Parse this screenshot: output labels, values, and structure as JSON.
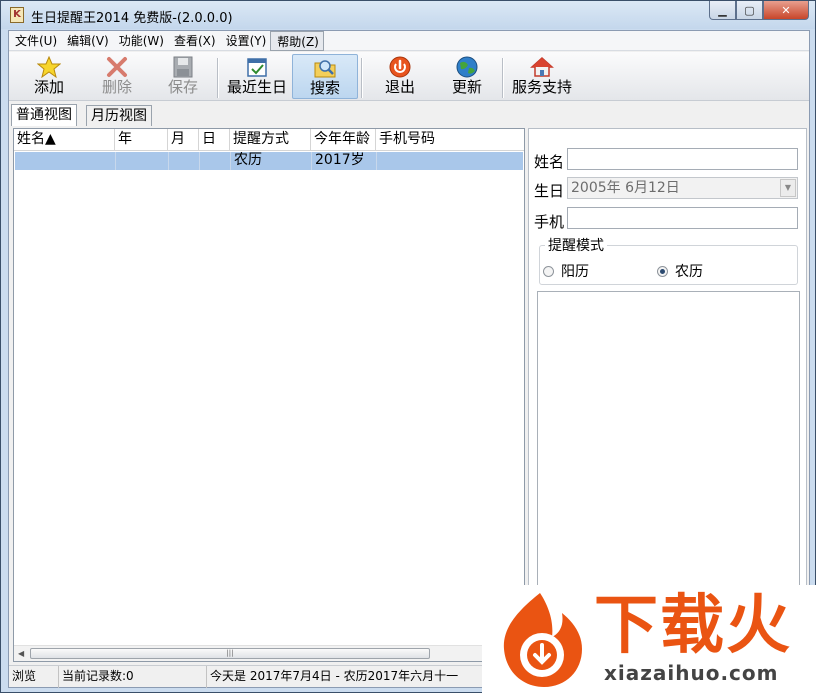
{
  "window": {
    "title": "生日提醒王2014 免费版-(2.0.0.0)",
    "app_icon": "K",
    "minimize": "▁",
    "maximize": "▢",
    "close": "✕"
  },
  "menu": [
    "文件(U)",
    "编辑(V)",
    "功能(W)",
    "查看(X)",
    "设置(Y)",
    "帮助(Z)"
  ],
  "toolbar": {
    "add": "添加",
    "delete": "删除",
    "save": "保存",
    "recent": "最近生日",
    "search": "搜索",
    "exit": "退出",
    "update": "更新",
    "support": "服务支持"
  },
  "tabs": {
    "normal": "普通视图",
    "calendar": "月历视图"
  },
  "list": {
    "columns": [
      "姓名▲",
      "年",
      "月",
      "日",
      "提醒方式",
      "今年年龄",
      "手机号码"
    ],
    "rows": [
      [
        "",
        "",
        "",
        "",
        "农历",
        "2017岁",
        ""
      ]
    ],
    "scroll_left": "◀",
    "scroll_grip": "|||"
  },
  "form": {
    "name_label": "姓名",
    "name_value": "",
    "birthday_label": "生日",
    "birthday_value": "2005年  6月12日",
    "phone_label": "手机",
    "phone_value": "",
    "mode_title": "提醒模式",
    "mode_solar": "阳历",
    "mode_lunar": "农历",
    "mode_selected": "农历"
  },
  "status": {
    "mode": "浏览",
    "count": "当前记录数:0",
    "today": "今天是 2017年7月4日 - 农历2017年六月十一"
  },
  "watermark": {
    "brand": "下载火",
    "url": "xiazaihuo.com"
  },
  "colors": {
    "selection": "#a9c7ea",
    "brand_orange": "#ea5412"
  }
}
